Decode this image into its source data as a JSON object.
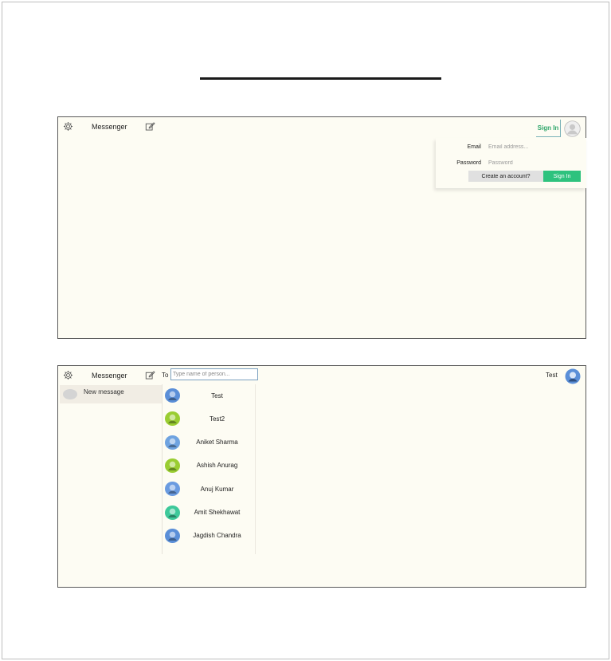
{
  "app": {
    "title": "Messenger"
  },
  "signin_screen": {
    "signin_link": "Sign In",
    "email_label": "Email",
    "email_placeholder": "Email address...",
    "password_label": "Password",
    "password_placeholder": "Password",
    "create_account_label": "Create an account?",
    "signin_button_label": "Sign In"
  },
  "message_screen": {
    "to_label": "To",
    "to_placeholder": "Type name of person...",
    "current_user": "Test",
    "new_message_label": "New message",
    "contacts": [
      {
        "name": "Test",
        "avatar_color": "#5b8fd8"
      },
      {
        "name": "Test2",
        "avatar_color": "#9acd32"
      },
      {
        "name": "Aniket Sharma",
        "avatar_color": "#6fa3e0"
      },
      {
        "name": "Ashish Anurag",
        "avatar_color": "#9acd32"
      },
      {
        "name": "Anuj Kumar",
        "avatar_color": "#6a9be0"
      },
      {
        "name": "Amit Shekhawat",
        "avatar_color": "#3ec99a"
      },
      {
        "name": "Jagdish Chandra",
        "avatar_color": "#5b8fd8"
      }
    ]
  },
  "colors": {
    "accent_green": "#2ec27e",
    "panel_background": "#fdfcf3"
  },
  "icons": [
    "gear-icon",
    "compose-icon",
    "user-avatar-icon"
  ]
}
